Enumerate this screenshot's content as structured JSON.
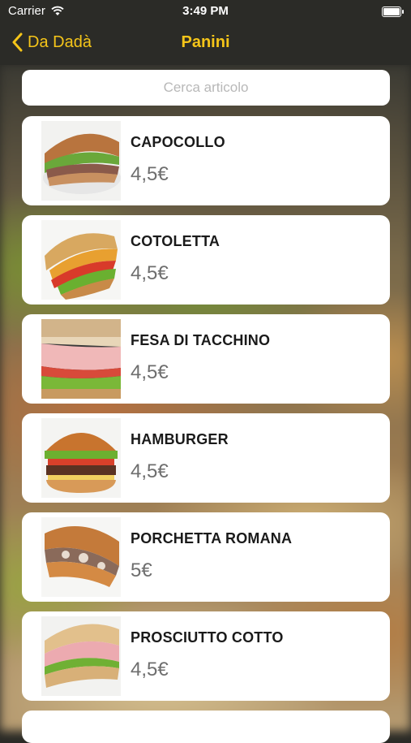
{
  "status_bar": {
    "carrier": "Carrier",
    "time": "3:49 PM"
  },
  "nav": {
    "back_label": "Da Dadà",
    "title": "Panini"
  },
  "search": {
    "placeholder": "Cerca articolo"
  },
  "items": [
    {
      "name": "CAPOCOLLO",
      "price": "4,5€"
    },
    {
      "name": "COTOLETTA",
      "price": "4,5€"
    },
    {
      "name": "FESA DI TACCHINO",
      "price": "4,5€"
    },
    {
      "name": "HAMBURGER",
      "price": "4,5€"
    },
    {
      "name": "PORCHETTA ROMANA",
      "price": "5€"
    },
    {
      "name": "PROSCIUTTO COTTO",
      "price": "4,5€"
    }
  ],
  "colors": {
    "accent": "#f5c519",
    "bar": "#2b2b27",
    "price": "#6e6e6e"
  }
}
